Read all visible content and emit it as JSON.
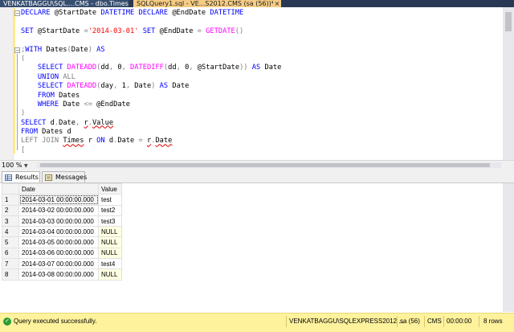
{
  "tabs": {
    "inactive_label": "VENKATBAGGU\\SQL....CMS - dbo.Times",
    "active_label": "SQLQuery1.sql - VE...S2012.CMS (sa (56))*",
    "close_glyph": "×"
  },
  "editor": {
    "lines": [
      [
        [
          "kw",
          "DECLARE "
        ],
        [
          "n",
          "@StartDate "
        ],
        [
          "kw",
          "DATETIME DECLARE "
        ],
        [
          "n",
          "@EndDate "
        ],
        [
          "kw",
          "DATETIME"
        ]
      ],
      [],
      [
        [
          "kw",
          "SET "
        ],
        [
          "n",
          "@StartDate "
        ],
        [
          "gray",
          "="
        ],
        [
          "str",
          "'2014-03-01'"
        ],
        [
          "kw",
          " SET "
        ],
        [
          "n",
          "@EndDate "
        ],
        [
          "gray",
          "= "
        ],
        [
          "fn",
          "GETDATE"
        ],
        [
          "gray",
          "()"
        ]
      ],
      [],
      [
        [
          "gray",
          ";"
        ],
        [
          "kw",
          "WITH "
        ],
        [
          "n",
          "Dates"
        ],
        [
          "gray",
          "("
        ],
        [
          "n",
          "Date"
        ],
        [
          "gray",
          ") "
        ],
        [
          "kw",
          "AS"
        ]
      ],
      [
        [
          "gray",
          "("
        ]
      ],
      [
        [
          "n",
          "    "
        ],
        [
          "kw",
          "SELECT "
        ],
        [
          "fn",
          "DATEADD"
        ],
        [
          "gray",
          "("
        ],
        [
          "n",
          "dd"
        ],
        [
          "gray",
          ", "
        ],
        [
          "n",
          "0"
        ],
        [
          "gray",
          ", "
        ],
        [
          "fn",
          "DATEDIFF"
        ],
        [
          "gray",
          "("
        ],
        [
          "n",
          "dd"
        ],
        [
          "gray",
          ", "
        ],
        [
          "n",
          "0"
        ],
        [
          "gray",
          ", "
        ],
        [
          "n",
          "@StartDate"
        ],
        [
          "gray",
          "))"
        ],
        [
          "kw",
          " AS "
        ],
        [
          "n",
          "Date"
        ]
      ],
      [
        [
          "n",
          "    "
        ],
        [
          "kw",
          "UNION "
        ],
        [
          "gray",
          "ALL"
        ]
      ],
      [
        [
          "n",
          "    "
        ],
        [
          "kw",
          "SELECT "
        ],
        [
          "fn",
          "DATEADD"
        ],
        [
          "gray",
          "("
        ],
        [
          "n",
          "day"
        ],
        [
          "gray",
          ", "
        ],
        [
          "n",
          "1"
        ],
        [
          "gray",
          ", "
        ],
        [
          "n",
          "Date"
        ],
        [
          "gray",
          ") "
        ],
        [
          "kw",
          "AS "
        ],
        [
          "n",
          "Date"
        ]
      ],
      [
        [
          "n",
          "    "
        ],
        [
          "kw",
          "FROM "
        ],
        [
          "n",
          "Dates"
        ]
      ],
      [
        [
          "n",
          "    "
        ],
        [
          "kw",
          "WHERE "
        ],
        [
          "n",
          "Date "
        ],
        [
          "gray",
          "<= "
        ],
        [
          "n",
          "@EndDate"
        ]
      ],
      [
        [
          "gray",
          ")"
        ]
      ],
      [
        [
          "kw",
          "SELECT "
        ],
        [
          "n",
          "d"
        ],
        [
          "gray",
          "."
        ],
        [
          "n",
          "Date"
        ],
        [
          "gray",
          ", "
        ],
        [
          "sq",
          "r"
        ],
        [
          "gray",
          "."
        ],
        [
          "sq",
          "Value"
        ]
      ],
      [
        [
          "kw",
          "FROM "
        ],
        [
          "n",
          "Dates d"
        ]
      ],
      [
        [
          "gray",
          "LEFT JOIN "
        ],
        [
          "sq",
          "Times"
        ],
        [
          "n",
          " r "
        ],
        [
          "kw",
          "ON "
        ],
        [
          "n",
          "d"
        ],
        [
          "gray",
          "."
        ],
        [
          "n",
          "Date "
        ],
        [
          "gray",
          "= "
        ],
        [
          "sq",
          "r"
        ],
        [
          "gray",
          "."
        ],
        [
          "sq",
          "Date"
        ]
      ],
      [
        [
          "gray",
          "["
        ]
      ]
    ],
    "zoom_label": "100 %"
  },
  "results_tabs": {
    "results_label": "Results",
    "messages_label": "Messages"
  },
  "grid": {
    "columns": [
      "Date",
      "Value"
    ],
    "rows": [
      {
        "n": "1",
        "date": "2014-03-01 00:00:00.000",
        "value": "test"
      },
      {
        "n": "2",
        "date": "2014-03-02 00:00:00.000",
        "value": "test2"
      },
      {
        "n": "3",
        "date": "2014-03-03 00:00:00.000",
        "value": "test3"
      },
      {
        "n": "4",
        "date": "2014-03-04 00:00:00.000",
        "value": "NULL"
      },
      {
        "n": "5",
        "date": "2014-03-05 00:00:00.000",
        "value": "NULL"
      },
      {
        "n": "6",
        "date": "2014-03-06 00:00:00.000",
        "value": "NULL"
      },
      {
        "n": "7",
        "date": "2014-03-07 00:00:00.000",
        "value": "test4"
      },
      {
        "n": "8",
        "date": "2014-03-08 00:00:00.000",
        "value": "NULL"
      }
    ]
  },
  "status": {
    "message": "Query executed successfully.",
    "server": "VENKATBAGGU\\SQLEXPRESS2012 ...",
    "user": "sa (56)",
    "database": "CMS",
    "elapsed": "00:00:00",
    "rows": "8 rows",
    "color": "#fff29d"
  }
}
